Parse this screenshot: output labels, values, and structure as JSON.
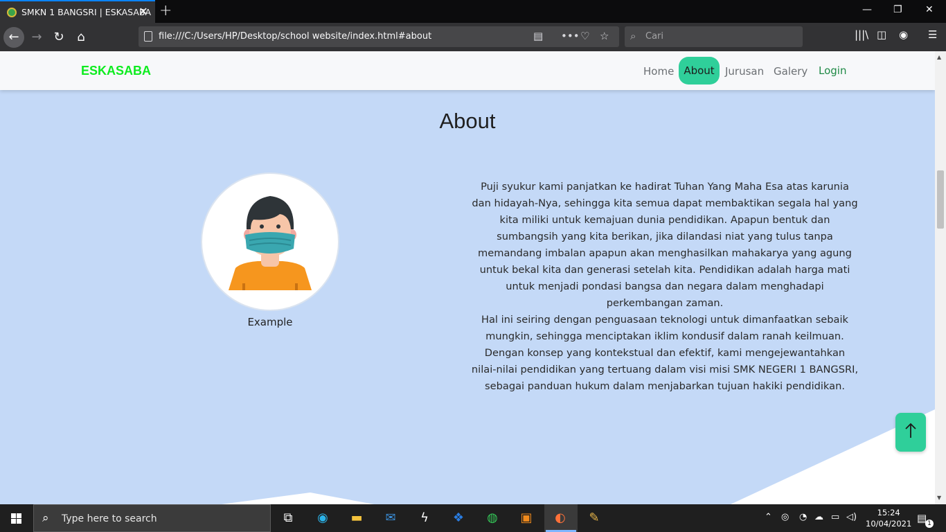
{
  "browser": {
    "tab_title": "SMKN 1 BANGSRI | ESKASABA",
    "url": "file:///C:/Users/HP/Desktop/school website/index.html#about",
    "search_placeholder": "Cari"
  },
  "site": {
    "brand": "ESKASABA",
    "nav": [
      {
        "label": "Home",
        "active": false
      },
      {
        "label": "About",
        "active": true
      },
      {
        "label": "Jurusan",
        "active": false
      },
      {
        "label": "Galery",
        "active": false
      }
    ],
    "login_label": "Login",
    "accent_color": "#2fcf9a",
    "brand_color": "#0dec1f",
    "background_color": "#c4d9f7"
  },
  "about": {
    "title": "About",
    "image_caption": "Example",
    "paragraph1": "Puji syukur kami panjatkan ke hadirat Tuhan Yang Maha Esa atas karunia dan hidayah-Nya, sehingga kita semua dapat membaktikan segala hal yang kita miliki untuk kemajuan dunia pendidikan. Apapun bentuk dan sumbangsih yang kita berikan, jika dilandasi niat yang tulus tanpa memandang imbalan apapun akan menghasilkan mahakarya yang agung untuk bekal kita dan generasi setelah kita. Pendidikan adalah harga mati untuk menjadi pondasi bangsa dan negara dalam menghadapi perkembangan zaman.",
    "paragraph2": "Hal ini seiring dengan penguasaan teknologi untuk dimanfaatkan sebaik mungkin, sehingga menciptakan iklim kondusif dalam ranah keilmuan. Dengan konsep yang kontekstual dan efektif, kami mengejewantahkan nilai-nilai pendidikan yang tertuang dalam visi misi SMK NEGERI 1 BANGSRI, sebagai panduan hukum dalam menjabarkan tujuan hakiki pendidikan."
  },
  "taskbar": {
    "search_text": "Type here to search",
    "time": "15:24",
    "date": "10/04/2021",
    "notification_count": "1"
  }
}
